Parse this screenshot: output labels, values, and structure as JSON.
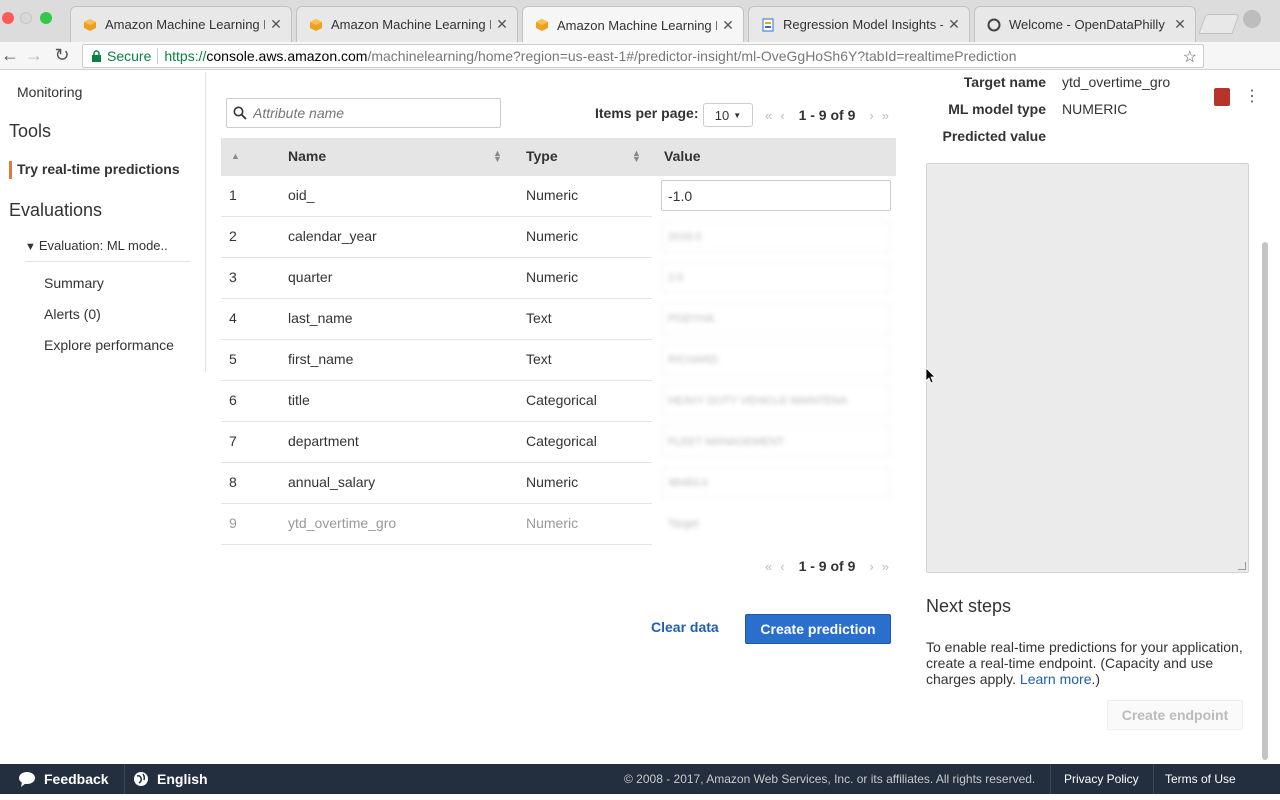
{
  "browser": {
    "tabs": [
      {
        "title": "Amazon Machine Learning Ma",
        "active": false
      },
      {
        "title": "Amazon Machine Learning Ma",
        "active": false
      },
      {
        "title": "Amazon Machine Learning Ma",
        "active": true
      },
      {
        "title": "Regression Model Insights - A",
        "active": false
      },
      {
        "title": "Welcome - OpenDataPhilly",
        "active": false
      }
    ],
    "close_glyph": "✕",
    "secure_label": "Secure",
    "url_scheme": "https://",
    "url_host": "console.aws.amazon.com",
    "url_path": "/machinelearning/home?region=us-east-1#/predictor-insight/ml-OveGgHoSh6Y?tabId=realtimePrediction"
  },
  "sidebar": {
    "monitoring": "Monitoring",
    "tools": "Tools",
    "try_realtime": "Try real-time predictions",
    "evaluations": "Evaluations",
    "evaluation_item": "Evaluation: ML mode..",
    "summary": "Summary",
    "alerts": "Alerts (0)",
    "explore": "Explore performance"
  },
  "table": {
    "search_placeholder": "Attribute name",
    "items_per_page_label": "Items per page:",
    "items_per_page_value": "10",
    "range": "1 - 9 of 9",
    "headers": {
      "name": "Name",
      "type": "Type",
      "value": "Value"
    },
    "rows": [
      {
        "index": "1",
        "name": "oid_",
        "type": "Numeric",
        "value": "-1.0"
      },
      {
        "index": "2",
        "name": "calendar_year",
        "type": "Numeric",
        "value": "2016.0"
      },
      {
        "index": "3",
        "name": "quarter",
        "type": "Numeric",
        "value": "2.0"
      },
      {
        "index": "4",
        "name": "last_name",
        "type": "Text",
        "value": "PODYHA"
      },
      {
        "index": "5",
        "name": "first_name",
        "type": "Text",
        "value": "RICHARD"
      },
      {
        "index": "6",
        "name": "title",
        "type": "Categorical",
        "value": "HEAVY DUTY VEHICLE MAINTENA"
      },
      {
        "index": "7",
        "name": "department",
        "type": "Categorical",
        "value": "FLEET MANAGEMENT"
      },
      {
        "index": "8",
        "name": "annual_salary",
        "type": "Numeric",
        "value": "48483.0"
      },
      {
        "index": "9",
        "name": "ytd_overtime_gro",
        "type": "Numeric",
        "value": "Target"
      }
    ],
    "clear_label": "Clear data",
    "create_prediction_label": "Create prediction"
  },
  "details": {
    "target_name_label": "Target name",
    "target_name_value": "ytd_overtime_gro",
    "model_type_label": "ML model type",
    "model_type_value": "NUMERIC",
    "predicted_value_label": "Predicted value"
  },
  "next_steps": {
    "title": "Next steps",
    "text": "To enable real-time predictions for your application, create a real-time endpoint. (Capacity and use charges apply. ",
    "learn_more": "Learn more",
    "text_end": ".)",
    "create_endpoint_label": "Create endpoint"
  },
  "footer": {
    "feedback": "Feedback",
    "language": "English",
    "copyright": "© 2008 - 2017, Amazon Web Services, Inc. or its affiliates. All rights reserved.",
    "privacy": "Privacy Policy",
    "terms": "Terms of Use"
  },
  "colors": {
    "accent_orange": "#e07941",
    "primary_blue": "#2b6fce",
    "link_blue": "#1f5fb0",
    "footer_bg": "#232f3e"
  }
}
